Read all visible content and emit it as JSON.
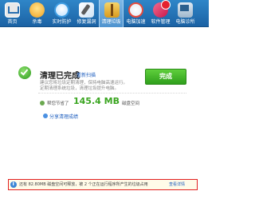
{
  "toolbar": {
    "items": [
      {
        "label": "首页",
        "icon": "home-icon"
      },
      {
        "label": "杀毒",
        "icon": "trojan-scan-icon"
      },
      {
        "label": "实时防护",
        "icon": "realtime-protect-icon"
      },
      {
        "label": "修复漏洞",
        "icon": "fix-icon"
      },
      {
        "label": "清理垃圾",
        "icon": "clean-broom-icon"
      },
      {
        "label": "电脑加速",
        "icon": "speedup-icon"
      },
      {
        "label": "软件管理",
        "icon": "software-icon"
      },
      {
        "label": "电脑诊所",
        "icon": "pc-clinic-icon"
      }
    ],
    "active_index": 4
  },
  "result": {
    "title": "清理已完成",
    "reclean_link": "重新扫描",
    "desc_line1": "建议您将垃圾定期清理，保持电脑高速运行。",
    "desc_line2": "定期清理系统垃圾，清理垃圾提升电脑。",
    "finish_button": "完成"
  },
  "saved": {
    "prefix": "帮您节省了",
    "size": "145.4 MB",
    "suffix": "磁盘空间"
  },
  "share_link": "分享清理成绩",
  "notice": {
    "text": "还有 82.80MB 磁盘空间可释放，被 2 个正在运行程序所产生的垃圾占用",
    "link": "查看详情"
  },
  "colors": {
    "toolbar_top": "#2f86c8",
    "toolbar_bottom": "#1b62a4",
    "success_green": "#3aa520",
    "link_blue": "#1f5fbf",
    "notice_border": "#e22020"
  }
}
